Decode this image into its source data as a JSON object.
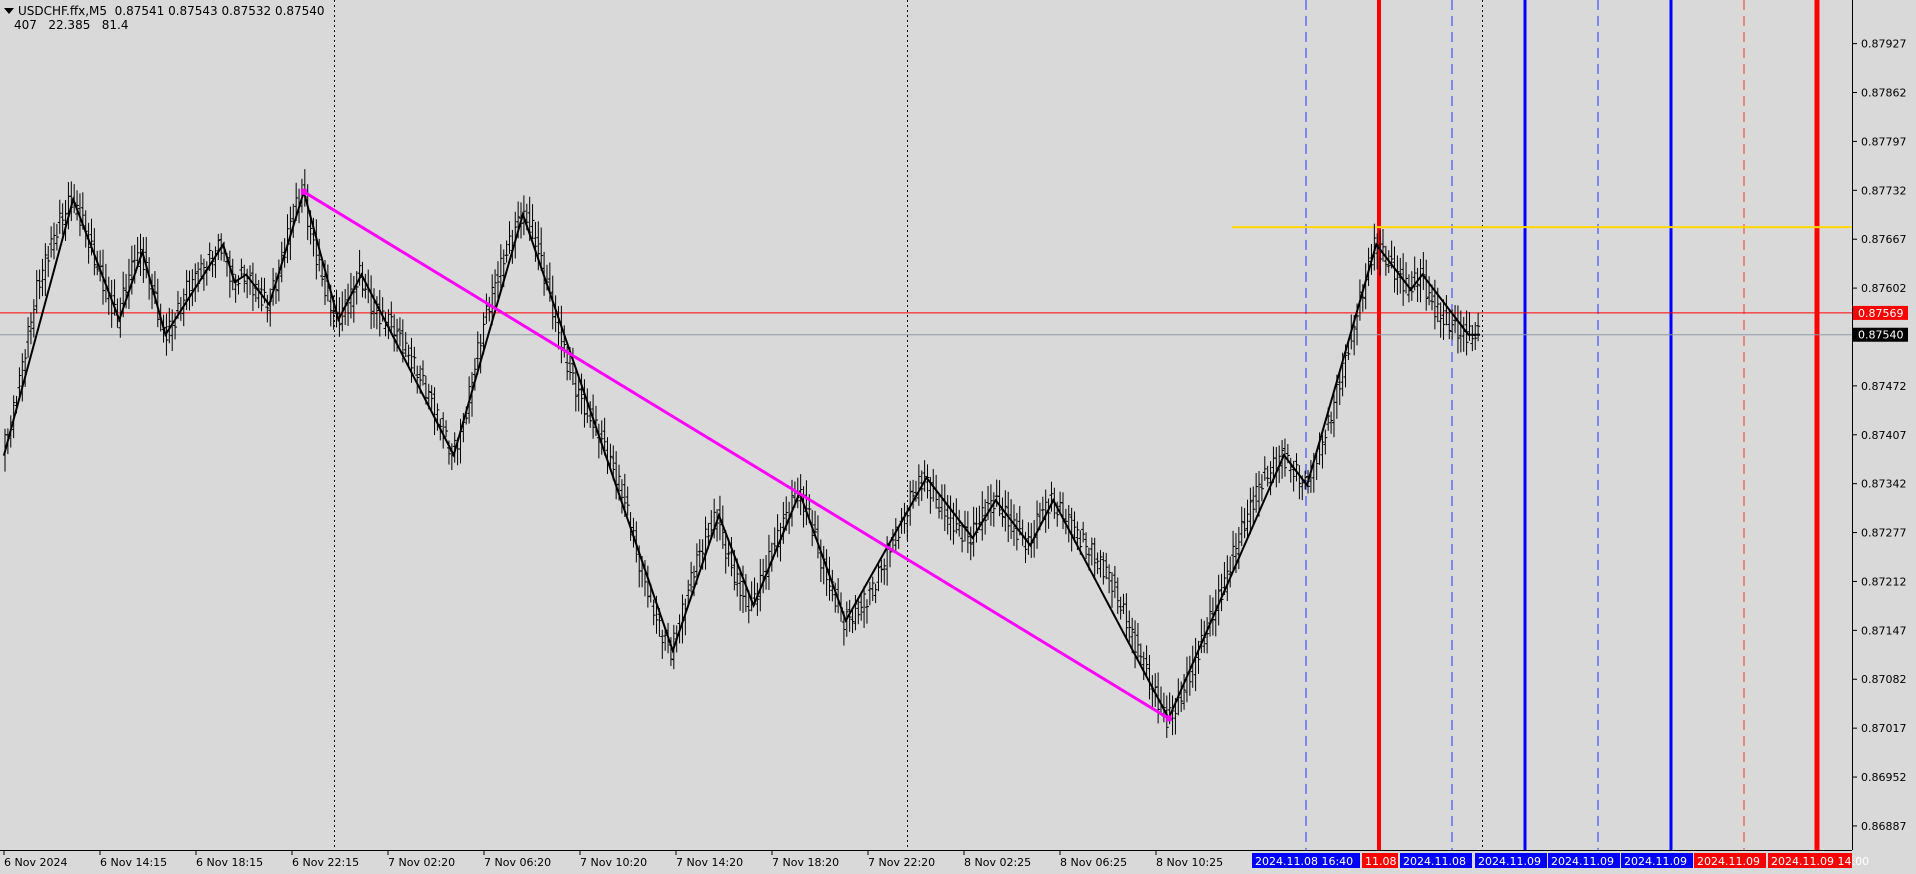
{
  "header": {
    "symbol_line": "USDCHF.ffx,M5  0.87541 0.87543 0.87532 0.87540",
    "indicator_line": "407   22.385   81.4"
  },
  "colors": {
    "background": "#d9d9d9",
    "bars": "#000000",
    "zigzag": "#000000",
    "trendline": "#ff00ff",
    "horizontal_yellow": "#ffd700",
    "horizontal_red": "#ff0000",
    "bid_line": "#8f9aa8",
    "vline_red": "#ff0000",
    "vline_blue": "#0000ff",
    "vline_blue_dash": "#2233ff",
    "vline_red_dash": "#ff3030",
    "time_label_blue": "#0000ff",
    "time_label_red": "#ff0000"
  },
  "chart_data": {
    "type": "candlestick-ohlc-bars",
    "symbol": "USDCHF.ffx",
    "timeframe": "M5",
    "ylim": [
      0.86855,
      0.87985
    ],
    "y_ticks": [
      "0.87927",
      "0.87862",
      "0.87797",
      "0.87732",
      "0.87667",
      "0.87602",
      "0.87537",
      "0.87472",
      "0.87407",
      "0.87342",
      "0.87277",
      "0.87212",
      "0.87147",
      "0.87082",
      "0.87017",
      "0.86952",
      "0.86887"
    ],
    "price_labels": [
      {
        "value": 0.87569,
        "text": "0.87569",
        "color": "#ff0000"
      },
      {
        "value": 0.8754,
        "text": "0.87540",
        "color": "#000000"
      }
    ],
    "x_ticks": [
      "6 Nov 2024",
      "6 Nov 14:15",
      "6 Nov 18:15",
      "6 Nov 22:15",
      "7 Nov 02:20",
      "7 Nov 06:20",
      "7 Nov 10:20",
      "7 Nov 14:20",
      "7 Nov 18:20",
      "7 Nov 22:20",
      "8 Nov 02:25",
      "8 Nov 06:25",
      "8 Nov 10:25"
    ],
    "time_labels": [
      {
        "text": "2024.11.08 16:40",
        "color": "blue"
      },
      {
        "text": "11.08",
        "color": "red"
      },
      {
        "text": "2024.11.08",
        "color": "blue"
      },
      {
        "text": "2024.11.09",
        "color": "blue"
      },
      {
        "text": "2024.11.09",
        "color": "blue"
      },
      {
        "text": "2024.11.09",
        "color": "blue"
      },
      {
        "text": "2024.11.09",
        "color": "red"
      },
      {
        "text": "2024.11.09 14:00",
        "color": "red"
      }
    ],
    "price_path": [
      [
        0.8738,
        0.8744,
        0.8752,
        0.876,
        0.8765,
        0.8769,
        0.8772,
        0.8769,
        0.8764,
        0.876,
        0.8756,
        0.8762,
        0.8765,
        0.876,
        0.8754,
        0.8756,
        0.876,
        0.8762,
        0.8764,
        0.8766
      ],
      [
        0.8761,
        0.8762,
        0.876,
        0.8758,
        0.8762,
        0.8769,
        0.8773,
        0.8766,
        0.876,
        0.8756,
        0.8758,
        0.8762,
        0.8758,
        0.8756,
        0.8755,
        0.8752,
        0.8749,
        0.8746,
        0.8742,
        0.8738
      ],
      [
        0.8742,
        0.875,
        0.8757,
        0.8762,
        0.8766,
        0.877,
        0.8768,
        0.8762,
        0.8756,
        0.875,
        0.8746,
        0.8743,
        0.874,
        0.8736,
        0.8732,
        0.8725,
        0.872,
        0.8715,
        0.8712,
        0.8717
      ],
      [
        0.8723,
        0.8727,
        0.873,
        0.8724,
        0.872,
        0.8718,
        0.8722,
        0.8726,
        0.873,
        0.8733,
        0.873,
        0.8724,
        0.872,
        0.8716,
        0.8717,
        0.8719,
        0.8722,
        0.8726,
        0.8729,
        0.8733
      ],
      [
        0.8735,
        0.8732,
        0.873,
        0.8728,
        0.8727,
        0.873,
        0.8732,
        0.873,
        0.8728,
        0.8726,
        0.873,
        0.8732,
        0.873,
        0.8728,
        0.8726,
        0.8724,
        0.8722,
        0.8718,
        0.8714,
        0.871
      ],
      [
        0.8706,
        0.8703,
        0.8705,
        0.8709,
        0.8713,
        0.8717,
        0.8721,
        0.8726,
        0.873,
        0.8734,
        0.8736,
        0.8738,
        0.8736,
        0.8734,
        0.8738,
        0.8742,
        0.8748,
        0.8754,
        0.876,
        0.8766
      ],
      [
        0.8764,
        0.8762,
        0.876,
        0.8762,
        0.8758,
        0.8756,
        0.8755,
        0.8754,
        0.8754
      ]
    ]
  }
}
